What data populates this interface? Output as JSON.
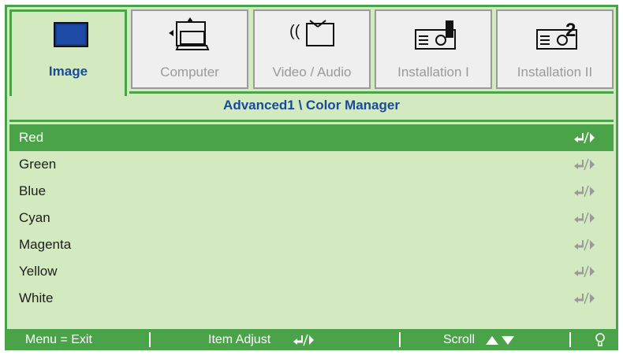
{
  "tabs": [
    {
      "label": "Image",
      "icon": "image-icon",
      "active": true
    },
    {
      "label": "Computer",
      "icon": "computer-icon",
      "active": false
    },
    {
      "label": "Video / Audio",
      "icon": "video-audio-icon",
      "active": false
    },
    {
      "label": "Installation I",
      "icon": "installation-icon",
      "active": false
    },
    {
      "label": "Installation II",
      "icon": "installation-2-icon",
      "active": false
    }
  ],
  "breadcrumb": "Advanced1 \\ Color Manager",
  "items": [
    {
      "label": "Red",
      "selected": true
    },
    {
      "label": "Green",
      "selected": false
    },
    {
      "label": "Blue",
      "selected": false
    },
    {
      "label": "Cyan",
      "selected": false
    },
    {
      "label": "Magenta",
      "selected": false
    },
    {
      "label": "Yellow",
      "selected": false
    },
    {
      "label": "White",
      "selected": false
    }
  ],
  "footer": {
    "menu_exit": "Menu = Exit",
    "item_adjust": "Item Adjust",
    "scroll": "Scroll"
  },
  "colors": {
    "accent": "#4aa349",
    "panel": "#d3e9c0",
    "title_text": "#1a4a9a",
    "tab_inactive": "#efefef"
  }
}
